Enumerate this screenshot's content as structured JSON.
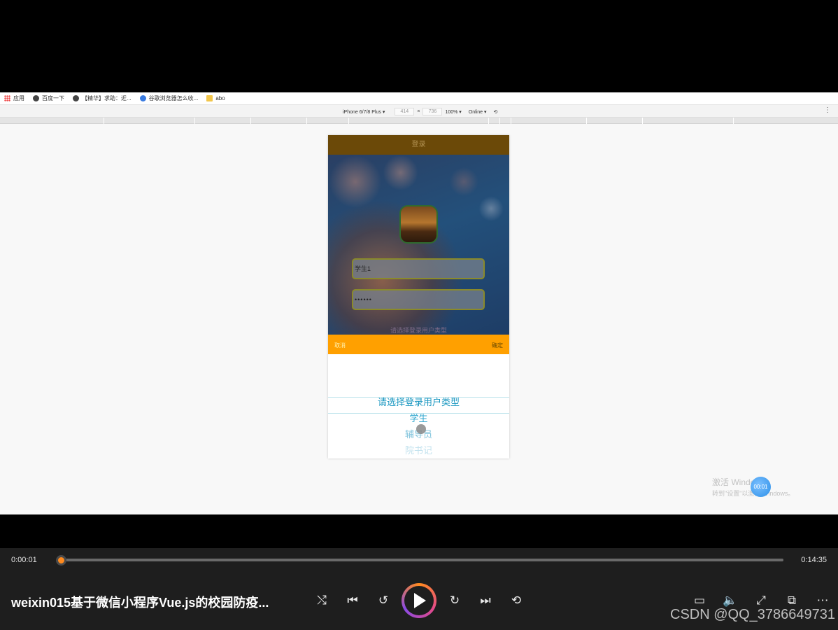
{
  "bookmarks": [
    {
      "label": "应用",
      "icon": "apps-icon"
    },
    {
      "label": "百度一下",
      "icon": "globe-icon"
    },
    {
      "label": "【精华】求助：近...",
      "icon": "globe-icon"
    },
    {
      "label": "谷歌浏览器怎么收...",
      "icon": "paw-icon"
    },
    {
      "label": "abo",
      "icon": "folder-icon"
    }
  ],
  "devtools": {
    "device": "iPhone 6/7/8 Plus ▾",
    "width": "414",
    "times": "×",
    "height": "736",
    "zoom": "100% ▾",
    "network": "Online ▾",
    "rotate_icon": "⟲",
    "menu_icon": "⋮"
  },
  "app": {
    "header_title": "登录",
    "username_value": "学生1",
    "password_value": "••••••",
    "hint": "请选择登录用户类型",
    "picker": {
      "cancel": "取消",
      "confirm": "确定",
      "options": [
        "请选择登录用户类型",
        "学生",
        "辅导员",
        "院书记"
      ]
    }
  },
  "watermark": {
    "line1": "激活 Windows",
    "line2": "转到\"设置\"以激活 Windows。",
    "timer": "00:01"
  },
  "player": {
    "current_time": "0:00:01",
    "total_time": "0:14:35",
    "progress": 0.0011,
    "title": "weixin015基于微信小程序Vue.js的校园防疫...",
    "watermark": "CSDN @QQ_3786649731",
    "colors": {
      "accent": "#ff8a1e"
    }
  }
}
